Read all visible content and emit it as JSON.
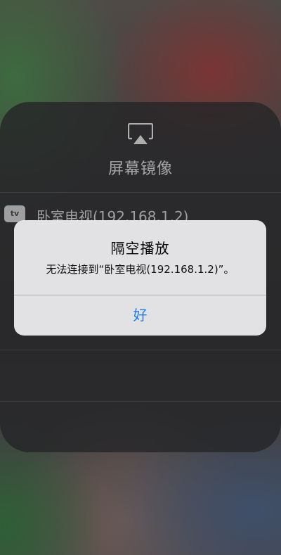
{
  "panel": {
    "icon": "airplay-icon",
    "title": "屏幕镜像",
    "devices": [
      {
        "badge": "tv",
        "badge_icon": "apple-tv-icon",
        "name": "卧室电视(192.168.1.2)"
      }
    ]
  },
  "alert": {
    "title": "隔空播放",
    "message": "无法连接到“卧室电视(192.168.1.2)”。",
    "ok_label": "好"
  },
  "colors": {
    "alert_button": "#1a7cf5",
    "panel_bg": "#262628",
    "alert_bg": "#e8e8ea"
  }
}
